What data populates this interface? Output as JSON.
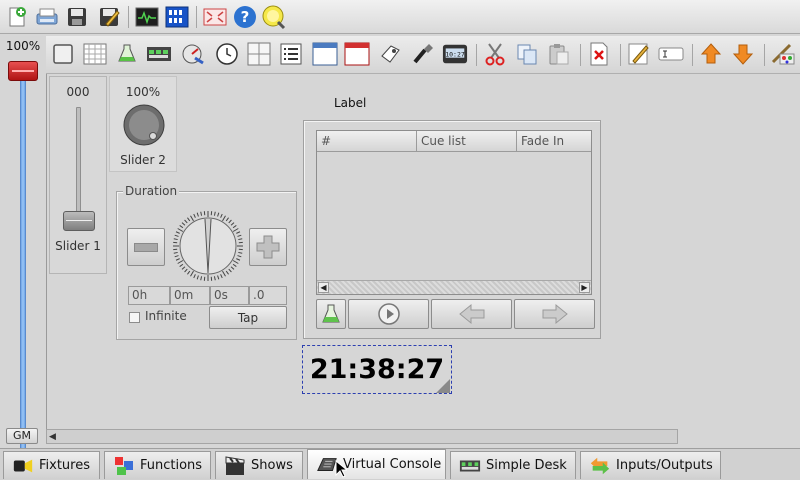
{
  "toolbar": {
    "icons": [
      "new-workspace-icon",
      "open-workspace-icon",
      "save-workspace-icon",
      "save-as-icon",
      "monitor-icon",
      "address-tool-icon",
      "fullscreen-icon",
      "help-icon",
      "operate-mode-icon"
    ]
  },
  "grand_master": {
    "value": "100%",
    "button": "GM",
    "level": 1.0
  },
  "vc_toolbar": {
    "icons": [
      "frame-icon",
      "solo-frame-icon",
      "button-icon",
      "button-matrix-icon",
      "speed-dial-icon",
      "clock-icon",
      "xy-pad-icon",
      "cue-list-icon",
      "label-icon",
      "frame-red-icon",
      "audio-triggers-icon",
      "slider-icon",
      "animation-icon",
      "cut-icon",
      "copy-icon",
      "paste-icon",
      "delete-icon",
      "edit-props-icon",
      "rename-icon",
      "bring-up-icon",
      "send-down-icon",
      "settings-icon"
    ]
  },
  "widgets": {
    "slider": {
      "value": "000",
      "label": "Slider 1",
      "level": 0.0
    },
    "knob": {
      "value": "100%",
      "label": "Slider 2"
    },
    "speed_dial": {
      "title": "Duration",
      "fields": [
        "0h",
        "0m",
        "0s",
        ".0"
      ],
      "infinite_label": "Infinite",
      "tap_label": "Tap"
    },
    "label_widget": {
      "text": "Label"
    },
    "cue_list": {
      "columns": [
        "#",
        "Cue list",
        "Fade In"
      ]
    },
    "clock": {
      "time": "21:38:27"
    }
  },
  "tabs": [
    {
      "label": "Fixtures",
      "icon": "fixtures-icon"
    },
    {
      "label": "Functions",
      "icon": "functions-icon"
    },
    {
      "label": "Shows",
      "icon": "shows-icon"
    },
    {
      "label": "Virtual Console",
      "icon": "virtual-console-icon",
      "active": true
    },
    {
      "label": "Simple Desk",
      "icon": "simple-desk-icon"
    },
    {
      "label": "Inputs/Outputs",
      "icon": "inputs-outputs-icon"
    }
  ]
}
